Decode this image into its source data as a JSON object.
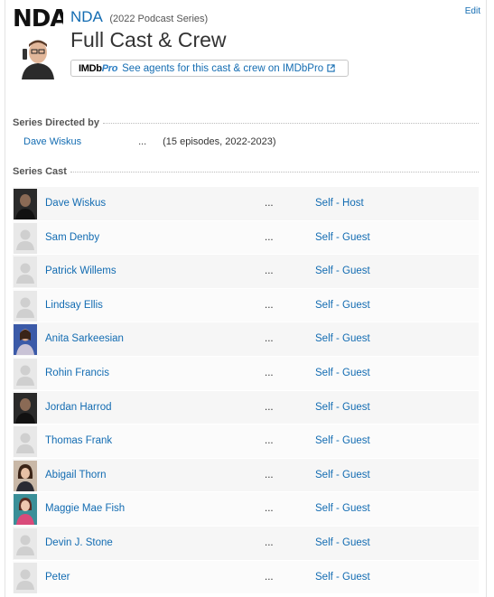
{
  "header": {
    "poster_logo": "NDA",
    "series_title": "NDA",
    "series_meta": "(2022 Podcast Series)",
    "page_title": "Full Cast & Crew",
    "edit_label": "Edit",
    "pro_logo_imdb": "IMDb",
    "pro_logo_pro": "Pro",
    "pro_link_text": "See agents for this cast & crew on IMDbPro"
  },
  "directed": {
    "heading": "Series Directed by",
    "name": "Dave Wiskus",
    "dots": "...",
    "credit": "(15 episodes, 2022-2023)"
  },
  "cast": {
    "heading": "Series Cast",
    "rows": [
      {
        "name": "Dave Wiskus",
        "dots": "...",
        "character": "Self - Host",
        "photo": "dark-portrait"
      },
      {
        "name": "Sam Denby",
        "dots": "...",
        "character": "Self - Guest",
        "photo": "placeholder"
      },
      {
        "name": "Patrick Willems",
        "dots": "...",
        "character": "Self - Guest",
        "photo": "placeholder"
      },
      {
        "name": "Lindsay Ellis",
        "dots": "...",
        "character": "Self - Guest",
        "photo": "placeholder"
      },
      {
        "name": "Anita Sarkeesian",
        "dots": "...",
        "character": "Self - Guest",
        "photo": "blue-portrait"
      },
      {
        "name": "Rohin Francis",
        "dots": "...",
        "character": "Self - Guest",
        "photo": "placeholder"
      },
      {
        "name": "Jordan Harrod",
        "dots": "...",
        "character": "Self - Guest",
        "photo": "dark-portrait"
      },
      {
        "name": "Thomas Frank",
        "dots": "...",
        "character": "Self - Guest",
        "photo": "placeholder"
      },
      {
        "name": "Abigail Thorn",
        "dots": "...",
        "character": "Self - Guest",
        "photo": "warm-portrait"
      },
      {
        "name": "Maggie Mae Fish",
        "dots": "...",
        "character": "Self - Guest",
        "photo": "teal-portrait"
      },
      {
        "name": "Devin J. Stone",
        "dots": "...",
        "character": "Self - Guest",
        "photo": "placeholder"
      },
      {
        "name": "Peter",
        "dots": "...",
        "character": "Self - Guest",
        "photo": "placeholder"
      }
    ]
  },
  "colors": {
    "link": "#136cb2",
    "row_odd": "#f6f6f6",
    "row_even": "#fbfbfb"
  }
}
